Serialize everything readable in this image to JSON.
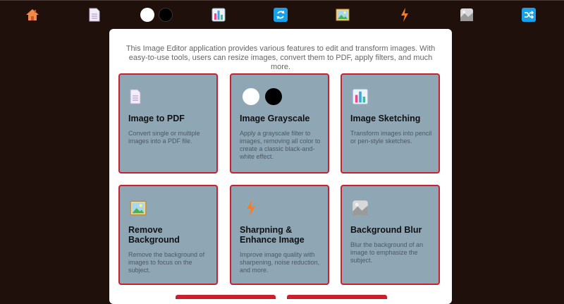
{
  "nav": {
    "icons": [
      "home-icon",
      "document-icon",
      "grayscale-toggle-icon",
      "sketch-chart-icon",
      "convert-arrows-icon",
      "image-landscape-icon",
      "lightning-icon",
      "blur-icon",
      "shuffle-icon"
    ]
  },
  "intro": "This Image Editor application provides various features to edit and transform images. With easy-to-use tools, users can resize images, convert them to PDF, apply filters, and much more.",
  "cards": [
    {
      "title": "Image to PDF",
      "desc": "Convert single or multiple images into a PDF file.",
      "icon": "document-icon"
    },
    {
      "title": "Image Grayscale",
      "desc": "Apply a grayscale filter to images, removing all color to create a classic black-and-white effect.",
      "icon": "grayscale-circles-icon"
    },
    {
      "title": "Image Sketching",
      "desc": "Transform images into pencil or pen-style sketches.",
      "icon": "sketch-chart-icon"
    },
    {
      "title": "Remove Background",
      "desc": "Remove the background of images to focus on the subject.",
      "icon": "image-landscape-icon"
    },
    {
      "title": "Sharpning & Enhance Image",
      "desc": "Improve image quality with sharpening, noise reduction, and more.",
      "icon": "lightning-icon"
    },
    {
      "title": "Background Blur",
      "desc": "Blur the background of an image to emphasize the subject.",
      "icon": "blur-icon"
    }
  ],
  "colors": {
    "background": "#1f100b",
    "card": "#8fa6b5",
    "card_border": "#cc1f2e"
  }
}
